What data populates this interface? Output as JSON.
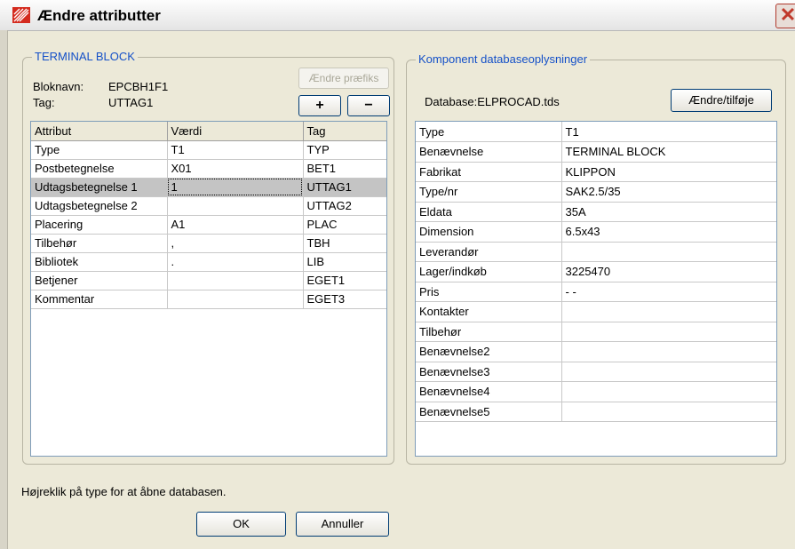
{
  "window": {
    "title": "Ændre attributter",
    "close": "✕"
  },
  "left_group": {
    "title": "TERMINAL BLOCK",
    "bloknavn_label": "Bloknavn:",
    "bloknavn_value": "EPCBH1F1",
    "tag_label": "Tag:",
    "tag_value": "UTTAG1",
    "prefix_button": "Ændre præfiks",
    "plus_button": "+",
    "minus_button": "−",
    "columns": [
      "Attribut",
      "Værdi",
      "Tag"
    ],
    "rows": [
      {
        "attr": "Type",
        "value": "T1",
        "tag": "TYP"
      },
      {
        "attr": "Postbetegnelse",
        "value": "X01",
        "tag": "BET1"
      },
      {
        "attr": "Udtagsbetegnelse 1",
        "value": "1",
        "tag": "UTTAG1"
      },
      {
        "attr": "Udtagsbetegnelse 2",
        "value": "",
        "tag": "UTTAG2"
      },
      {
        "attr": "Placering",
        "value": "A1",
        "tag": "PLAC"
      },
      {
        "attr": "Tilbehør",
        "value": ",",
        "tag": "TBH"
      },
      {
        "attr": "Bibliotek",
        "value": ".",
        "tag": "LIB"
      },
      {
        "attr": "Betjener",
        "value": "",
        "tag": "EGET1"
      },
      {
        "attr": "Kommentar",
        "value": "",
        "tag": "EGET3"
      }
    ],
    "selected_row": 2
  },
  "right_group": {
    "title": "Komponent databaseoplysninger",
    "database_label": "Database:ELPROCAD.tds",
    "edit_button": "Ændre/tilføje",
    "rows": [
      {
        "key": "Type",
        "value": "T1"
      },
      {
        "key": "Benævnelse",
        "value": "TERMINAL BLOCK"
      },
      {
        "key": "Fabrikat",
        "value": "KLIPPON"
      },
      {
        "key": "Type/nr",
        "value": "SAK2.5/35"
      },
      {
        "key": "Eldata",
        "value": "35A"
      },
      {
        "key": "Dimension",
        "value": "6.5x43"
      },
      {
        "key": "Leverandør",
        "value": ""
      },
      {
        "key": "Lager/indkøb",
        "value": "3225470"
      },
      {
        "key": "Pris",
        "value": "-   -"
      },
      {
        "key": "Kontakter",
        "value": ""
      },
      {
        "key": "Tilbehør",
        "value": ""
      },
      {
        "key": "Benævnelse2",
        "value": ""
      },
      {
        "key": "Benævnelse3",
        "value": ""
      },
      {
        "key": "Benævnelse4",
        "value": ""
      },
      {
        "key": "Benævnelse5",
        "value": ""
      }
    ]
  },
  "footer": {
    "hint": "Højreklik på type for at åbne databasen.",
    "ok_button": "OK",
    "cancel_button": "Annuller"
  },
  "colors": {
    "group_title": "#1450c8",
    "dialog_bg": "#ece9d8",
    "selection": "#c4c4c4"
  }
}
